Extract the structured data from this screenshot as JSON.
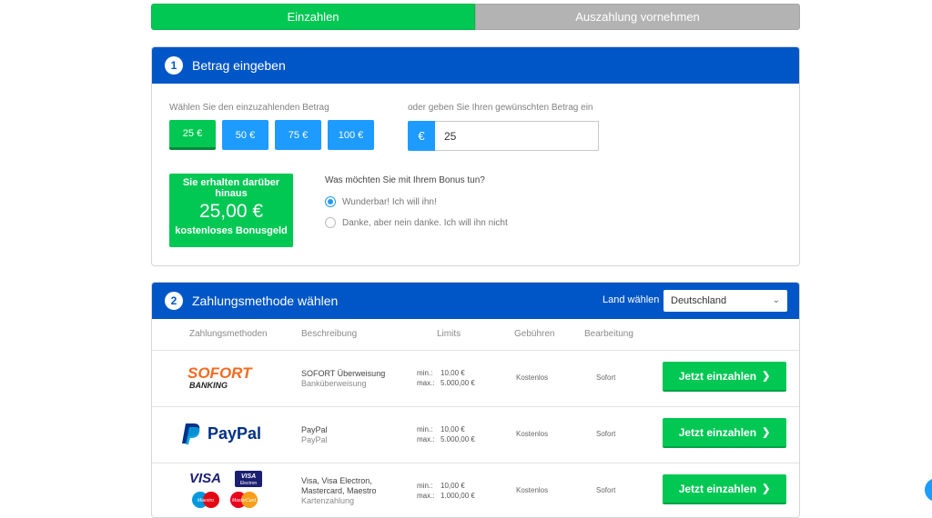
{
  "tabs": {
    "deposit": "Einzahlen",
    "withdraw": "Auszahlung vornehmen"
  },
  "step1": {
    "number": "1",
    "title": "Betrag eingeben",
    "choose_label": "Wählen Sie den einzuzahlenden Betrag",
    "custom_label": "oder geben Sie Ihren gewünschten Betrag ein",
    "amounts": [
      "25 €",
      "50 €",
      "75 €",
      "100 €"
    ],
    "selected_amount_index": 0,
    "currency_symbol": "€",
    "amount_value": "25",
    "bonus": {
      "line1": "Sie erhalten darüber hinaus",
      "value": "25,00 €",
      "line3": "kostenloses Bonusgeld"
    },
    "bonus_question": "Was möchten Sie mit Ihrem Bonus tun?",
    "options": [
      "Wunderbar! Ich will ihn!",
      "Danke, aber nein danke. Ich will ihn nicht"
    ],
    "selected_option_index": 0
  },
  "step2": {
    "number": "2",
    "title": "Zahlungsmethode wählen",
    "country_label": "Land wählen",
    "country_value": "Deutschland",
    "columns": [
      "Zahlungsmethoden",
      "Beschreibung",
      "Limits",
      "Gebühren",
      "Bearbeitung"
    ],
    "limit_labels": {
      "min": "min.:",
      "max": "max.:"
    },
    "methods": [
      {
        "logo": "SOFORT BANKING",
        "logo_top": "SOFORT",
        "logo_bottom": "BANKING",
        "name": "SOFORT Überweisung",
        "desc": "Banküberweisung",
        "min": "10,00 €",
        "max": "5.000,00 €",
        "fee": "Kostenlos",
        "processing": "Sofort",
        "button": "Jetzt einzahlen"
      },
      {
        "logo": "PayPal",
        "name": "PayPal",
        "desc": "PayPal",
        "min": "10,00 €",
        "max": "5.000,00 €",
        "fee": "Kostenlos",
        "processing": "Sofort",
        "button": "Jetzt einzahlen"
      },
      {
        "logo": "VISA / Visa Electron / Maestro / MasterCard",
        "logo_visa": "VISA",
        "logo_visa_e1": "VISA",
        "logo_visa_e2": "Electron",
        "logo_maestro": "Maestro",
        "logo_mc": "MasterCard",
        "name": "Visa, Visa Electron, Mastercard, Maestro",
        "desc": "Kartenzahlung",
        "min": "10,00 €",
        "max": "1.000,00 €",
        "fee": "Kostenlos",
        "processing": "Sofort",
        "button": "Jetzt einzahlen"
      }
    ]
  },
  "colors": {
    "green": "#00c853",
    "blue_header": "#0056c7",
    "blue_button": "#1e9bff",
    "grey_tab": "#b3b3b3"
  }
}
